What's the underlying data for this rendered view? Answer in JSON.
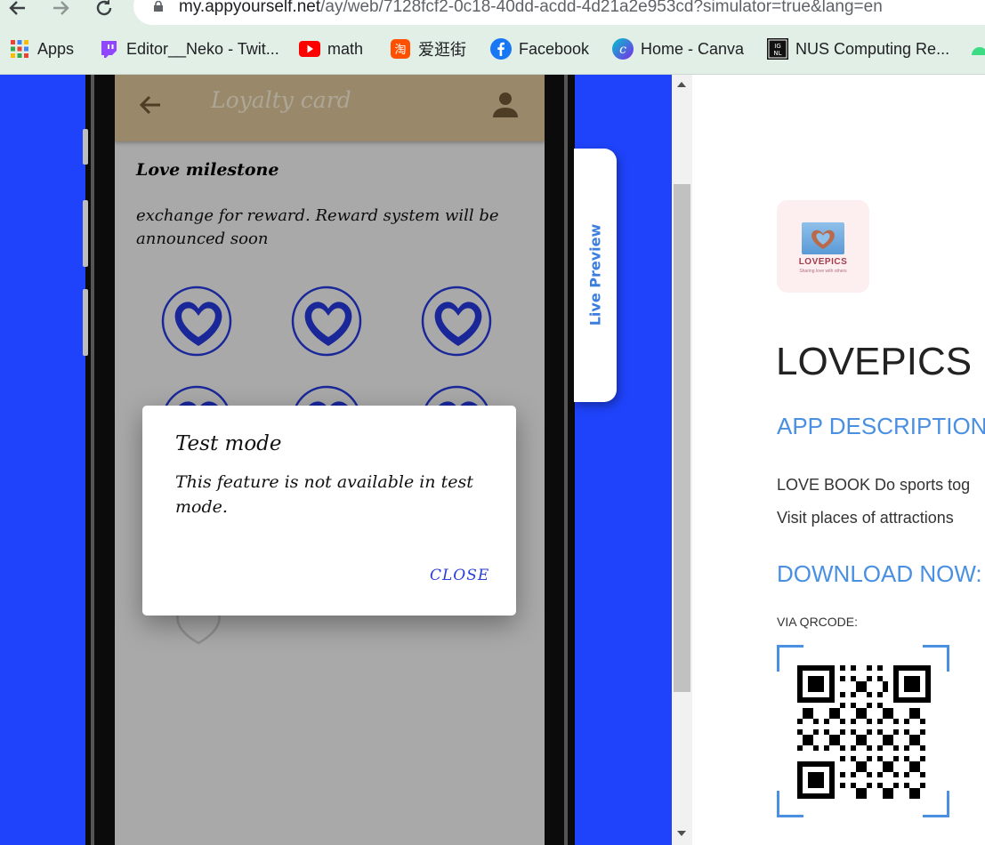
{
  "browser": {
    "url_host": "my.appyourself.net",
    "url_path": "/ay/web/7128fcf2-0c18-40dd-acdd-4d21a2e953cd?simulator=true&lang=en",
    "bookmarks": [
      {
        "label": "Apps",
        "icon": "apps-grid-icon",
        "color": "#4285f4"
      },
      {
        "label": "Editor__Neko - Twit...",
        "icon": "twitch-icon",
        "color": "#9146ff"
      },
      {
        "label": "math",
        "icon": "youtube-icon",
        "color": "#ff0000"
      },
      {
        "label": "爱逛街",
        "icon": "taobao-icon",
        "color": "#ff5000"
      },
      {
        "label": "Facebook",
        "icon": "facebook-icon",
        "color": "#1877f2"
      },
      {
        "label": "Home - Canva",
        "icon": "canva-icon",
        "color": "#7d2ae8"
      },
      {
        "label": "NUS Computing Re...",
        "icon": "ignl-icon",
        "color": "#111111"
      }
    ]
  },
  "simulator": {
    "app_bar_title": "Loyalty card",
    "section_title": "Love milestone",
    "section_text": "exchange for reward. Reward system will be announced soon",
    "live_preview_label": "Live Preview",
    "accent": "#1f43fa",
    "header_color": "#d8c196"
  },
  "dialog": {
    "title": "Test mode",
    "message": "This feature is not available in test mode.",
    "close_label": "CLOSE"
  },
  "panel": {
    "icon_brand": "LOVEPICS",
    "icon_tagline": "Sharing love with others",
    "app_name": "LOVEPICS",
    "description_heading": "APP DESCRIPTION",
    "description_line1": "LOVE BOOK Do sports tog",
    "description_line2": "Visit places of attractions",
    "download_heading": "DOWNLOAD NOW:",
    "qr_label": "VIA QRCODE:",
    "heading_color": "#4a90e2"
  }
}
